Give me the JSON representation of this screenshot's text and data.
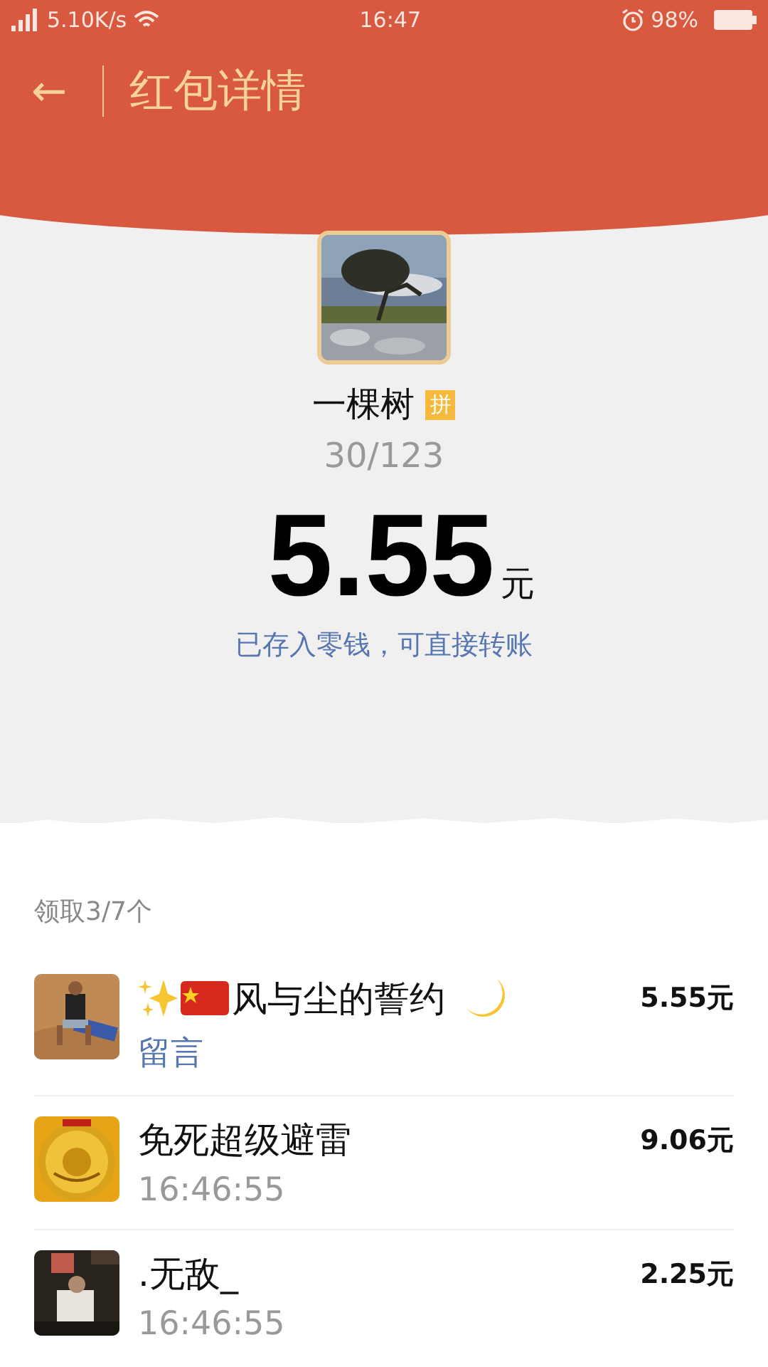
{
  "status_bar": {
    "network": "5.10K/s",
    "time": "16:47",
    "battery": "98%"
  },
  "title_bar": {
    "back": "←",
    "title": "红包详情"
  },
  "sender": {
    "name": "一棵树",
    "badge": "拼",
    "progress": "30/123"
  },
  "amount": {
    "value": "5.55",
    "unit": "元",
    "note": "已存入零钱，可直接转账"
  },
  "claims": {
    "summary": "领取3/7个",
    "items": [
      {
        "kind": "message",
        "name": "风与尘的誓约",
        "decorated": true,
        "amount": "5.55元",
        "sub": "留言"
      },
      {
        "kind": "time",
        "name": "免死超级避雷",
        "decorated": false,
        "amount": "9.06元",
        "sub": "16:46:55"
      },
      {
        "kind": "time",
        "name": ".无敌_",
        "decorated": false,
        "amount": "2.25元",
        "sub": "16:46:55"
      }
    ]
  }
}
